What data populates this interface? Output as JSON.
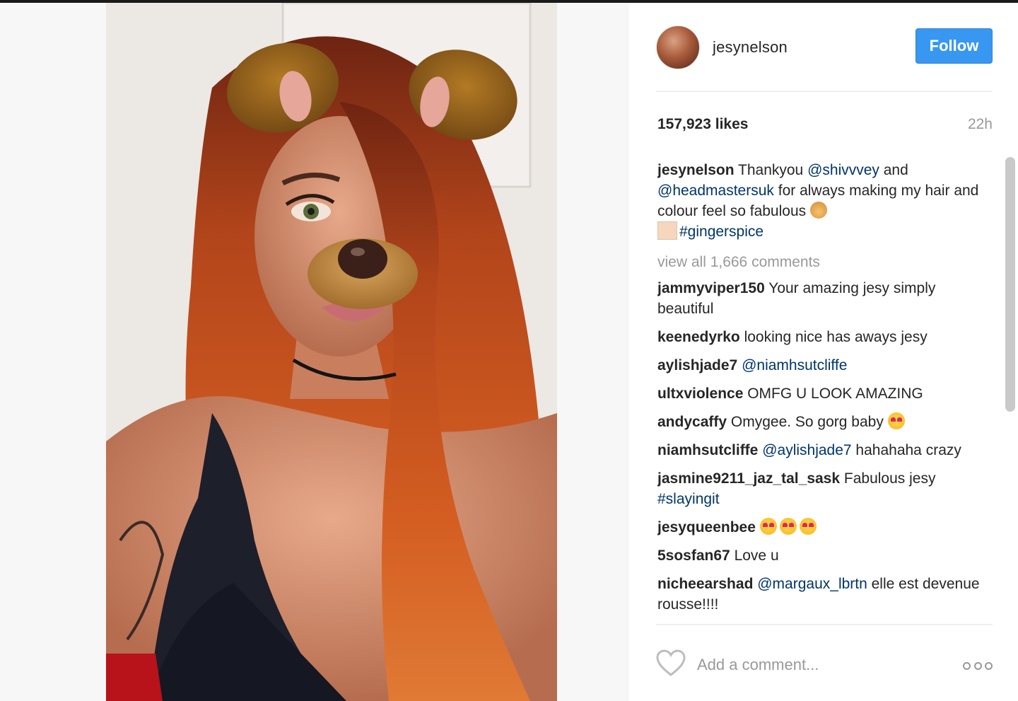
{
  "post": {
    "username": "jesynelson",
    "follow_label": "Follow",
    "likes": "157,923 likes",
    "time": "22h",
    "caption": {
      "user": "jesynelson",
      "t1": " Thankyou ",
      "mention1": "@shivvvey",
      "t2": " and ",
      "mention2": "@headmastersuk",
      "t3": " for always making my hair and colour feel so fabulous ",
      "hashtag": "#gingerspice"
    },
    "view_all": "view all 1,666 comments",
    "comments": [
      {
        "user": "jammyviper150",
        "text": " Your amazing jesy simply beautiful"
      },
      {
        "user": "keenedyrko",
        "text": " looking nice has aways jesy"
      },
      {
        "user": "aylishjade7",
        "tag": " @niamhsutcliffe"
      },
      {
        "user": "ultxviolence",
        "text": " OMFG U LOOK AMAZING"
      },
      {
        "user": "andycaffy",
        "text": " Omygee. So gorg baby "
      },
      {
        "user": "niamhsutcliffe",
        "tag": " @aylishjade7",
        "text": " hahahaha crazy"
      },
      {
        "user": "jasmine9211_jaz_tal_sask",
        "text": " Fabulous jesy ",
        "tag": "#slayingit"
      },
      {
        "user": "jesyqueenbee",
        "text": " "
      },
      {
        "user": "5sosfan67",
        "text": " Love u"
      },
      {
        "user": "nicheearshad",
        "tag": " @margaux_lbrtn",
        "text": " elle est devenue rousse!!!!"
      }
    ],
    "add_comment_placeholder": "Add a comment..."
  },
  "icons": {
    "like": "heart-outline-icon",
    "more": "more-options-icon"
  },
  "colors": {
    "follow_button": "#3897f0",
    "link": "#003569",
    "muted": "#999999"
  }
}
